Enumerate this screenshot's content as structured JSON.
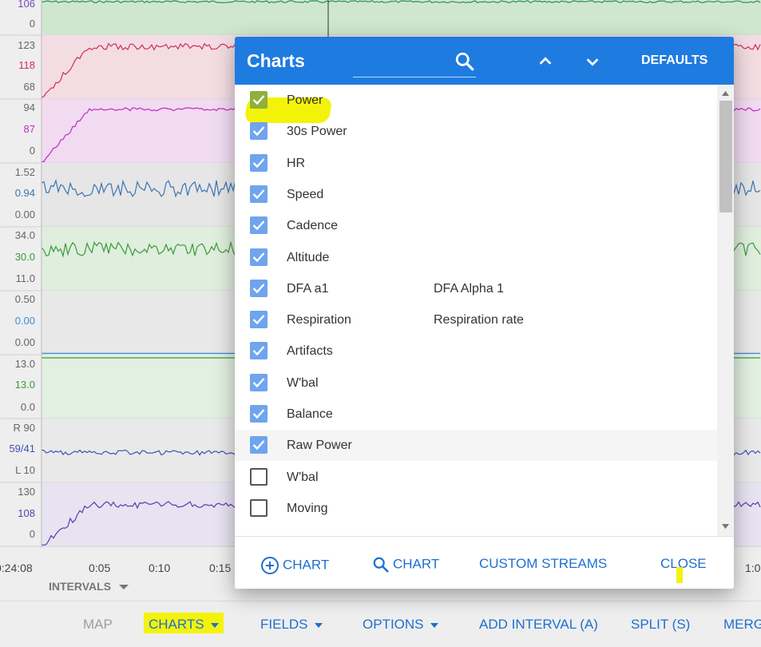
{
  "background": {
    "y_labels": [
      {
        "text": "106",
        "color": "#6f4fbf"
      },
      {
        "text": "0",
        "color": "#666666"
      },
      {
        "text": "123",
        "color": "#666666"
      },
      {
        "text": "118",
        "color": "#d22b5a"
      },
      {
        "text": "68",
        "color": "#666666"
      },
      {
        "text": "94",
        "color": "#666666"
      },
      {
        "text": "87",
        "color": "#c427c4"
      },
      {
        "text": "0",
        "color": "#666666"
      },
      {
        "text": "1.52",
        "color": "#666666"
      },
      {
        "text": "0.94",
        "color": "#3b74b3"
      },
      {
        "text": "0.00",
        "color": "#666666"
      },
      {
        "text": "34.0",
        "color": "#666666"
      },
      {
        "text": "30.0",
        "color": "#3a9a3a"
      },
      {
        "text": "11.0",
        "color": "#666666"
      },
      {
        "text": "0.50",
        "color": "#666666"
      },
      {
        "text": "0.00",
        "color": "#3b8ee0"
      },
      {
        "text": "0.00",
        "color": "#666666"
      },
      {
        "text": "13.0",
        "color": "#666666"
      },
      {
        "text": "13.0",
        "color": "#3a9a3a"
      },
      {
        "text": "0.0",
        "color": "#666666"
      },
      {
        "text": "R 90",
        "color": "#666666"
      },
      {
        "text": "59/41",
        "color": "#4050b5"
      },
      {
        "text": "L 10",
        "color": "#666666"
      },
      {
        "text": "130",
        "color": "#666666"
      },
      {
        "text": "108",
        "color": "#5a3bb0"
      },
      {
        "text": "0",
        "color": "#666666"
      }
    ],
    "x_labels": [
      "0:24:08",
      "0:05",
      "0:10",
      "0:15",
      "1:0"
    ],
    "intervals_label": "INTERVALS"
  },
  "bottom_bar": {
    "map": "MAP",
    "charts": "CHARTS",
    "fields": "FIELDS",
    "options": "OPTIONS",
    "add_interval": "ADD INTERVAL (A)",
    "split": "SPLIT (S)",
    "merge": "MERG"
  },
  "dialog": {
    "title": "Charts",
    "search_placeholder": "",
    "defaults_label": "DEFAULTS",
    "rows": [
      {
        "name": "Power",
        "desc": "",
        "checked": true
      },
      {
        "name": "30s Power",
        "desc": "",
        "checked": true
      },
      {
        "name": "HR",
        "desc": "",
        "checked": true
      },
      {
        "name": "Speed",
        "desc": "",
        "checked": true
      },
      {
        "name": "Cadence",
        "desc": "",
        "checked": true
      },
      {
        "name": "Altitude",
        "desc": "",
        "checked": true
      },
      {
        "name": "DFA a1",
        "desc": "DFA Alpha 1",
        "checked": true
      },
      {
        "name": "Respiration",
        "desc": "Respiration rate",
        "checked": true
      },
      {
        "name": "Artifacts",
        "desc": "",
        "checked": true
      },
      {
        "name": "W'bal",
        "desc": "",
        "checked": true
      },
      {
        "name": "Balance",
        "desc": "",
        "checked": true
      },
      {
        "name": "Raw Power",
        "desc": "",
        "checked": true
      },
      {
        "name": "W'bal",
        "desc": "",
        "checked": false
      },
      {
        "name": "Moving",
        "desc": "",
        "checked": false
      }
    ],
    "footer": {
      "add_chart": "CHART",
      "search_chart": "CHART",
      "custom_streams": "CUSTOM STREAMS",
      "close": "CLOSE"
    }
  },
  "colors": {
    "accent": "#1e7be0",
    "link": "#1e6fd1",
    "checkbox": "#6fa4ee",
    "highlight": "#f3f30a"
  }
}
